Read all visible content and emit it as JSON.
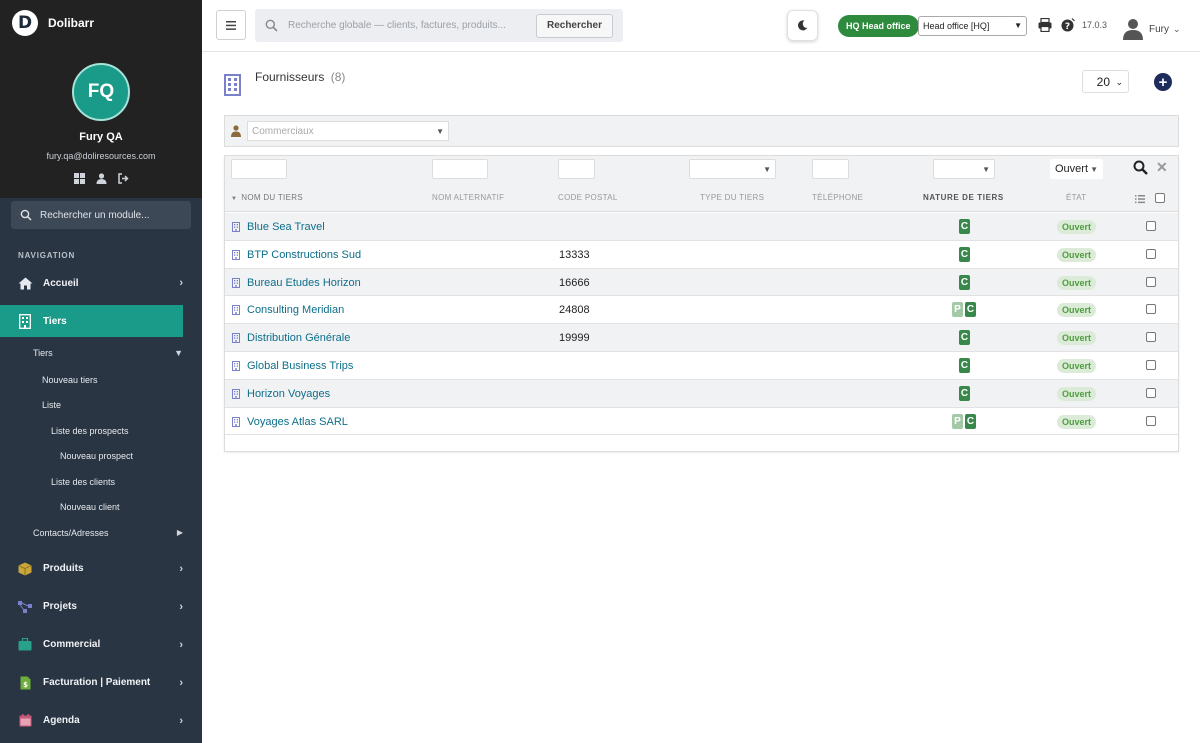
{
  "app": {
    "name": "Dolibarr",
    "logo_letter": "D"
  },
  "user": {
    "initials": "FQ",
    "name": "Fury QA",
    "email": "fury.qa@doliresources.com",
    "short_name": "Fury"
  },
  "sidebar": {
    "search_placeholder": "Rechercher un module...",
    "nav_heading": "NAVIGATION",
    "items": [
      {
        "label": "Accueil"
      },
      {
        "label": "Tiers"
      },
      {
        "label": "Produits"
      },
      {
        "label": "Projets"
      },
      {
        "label": "Commercial"
      },
      {
        "label": "Facturation | Paiement"
      },
      {
        "label": "Agenda"
      }
    ],
    "sub": {
      "tiers": "Tiers",
      "nouveau_tiers": "Nouveau tiers",
      "liste": "Liste",
      "liste_prospects": "Liste des prospects",
      "nouveau_prospect": "Nouveau prospect",
      "liste_clients": "Liste des clients",
      "nouveau_client": "Nouveau client",
      "contacts": "Contacts/Adresses"
    }
  },
  "topbar": {
    "search_placeholder": "Recherche globale — clients, factures, produits...",
    "search_button": "Rechercher",
    "entity_badge": "HQ  Head office",
    "entity_select": "Head office [HQ]",
    "version": "17.0.3"
  },
  "page": {
    "title": "Fournisseurs",
    "count": "(8)",
    "limit": "20",
    "commercial_placeholder": "Commerciaux",
    "state_filter": "Ouvert"
  },
  "table": {
    "headers": {
      "name": "NOM DU TIERS",
      "alt_name": "NOM ALTERNATIF",
      "postal": "CODE POSTAL",
      "type": "TYPE DU TIERS",
      "phone": "TÉLÉPHONE",
      "nature": "NATURE DE TIERS",
      "state": "ÉTAT"
    },
    "rows": [
      {
        "name": "Blue Sea Travel",
        "postal": "",
        "prospect": false,
        "client": "C",
        "state": "Ouvert"
      },
      {
        "name": "BTP Constructions Sud",
        "postal": "13333",
        "prospect": false,
        "client": "C",
        "state": "Ouvert"
      },
      {
        "name": "Bureau Etudes Horizon",
        "postal": "16666",
        "prospect": false,
        "client": "C",
        "state": "Ouvert"
      },
      {
        "name": "Consulting Meridian",
        "postal": "24808",
        "prospect": true,
        "prospect_label": "P",
        "client": "C",
        "state": "Ouvert"
      },
      {
        "name": "Distribution Générale",
        "postal": "19999",
        "prospect": false,
        "client": "C",
        "state": "Ouvert"
      },
      {
        "name": "Global Business Trips",
        "postal": "",
        "prospect": false,
        "client": "C",
        "state": "Ouvert"
      },
      {
        "name": "Horizon Voyages",
        "postal": "",
        "prospect": false,
        "client": "C",
        "state": "Ouvert"
      },
      {
        "name": "Voyages Atlas SARL",
        "postal": "",
        "prospect": true,
        "prospect_label": "P",
        "client": "C",
        "state": "Ouvert"
      }
    ]
  },
  "colors": {
    "accent": "#1a9a88",
    "sidebar_bg": "#2a3543",
    "link": "#0d6e8a",
    "client_badge": "#38884c",
    "state_bg": "#dcebd7"
  }
}
